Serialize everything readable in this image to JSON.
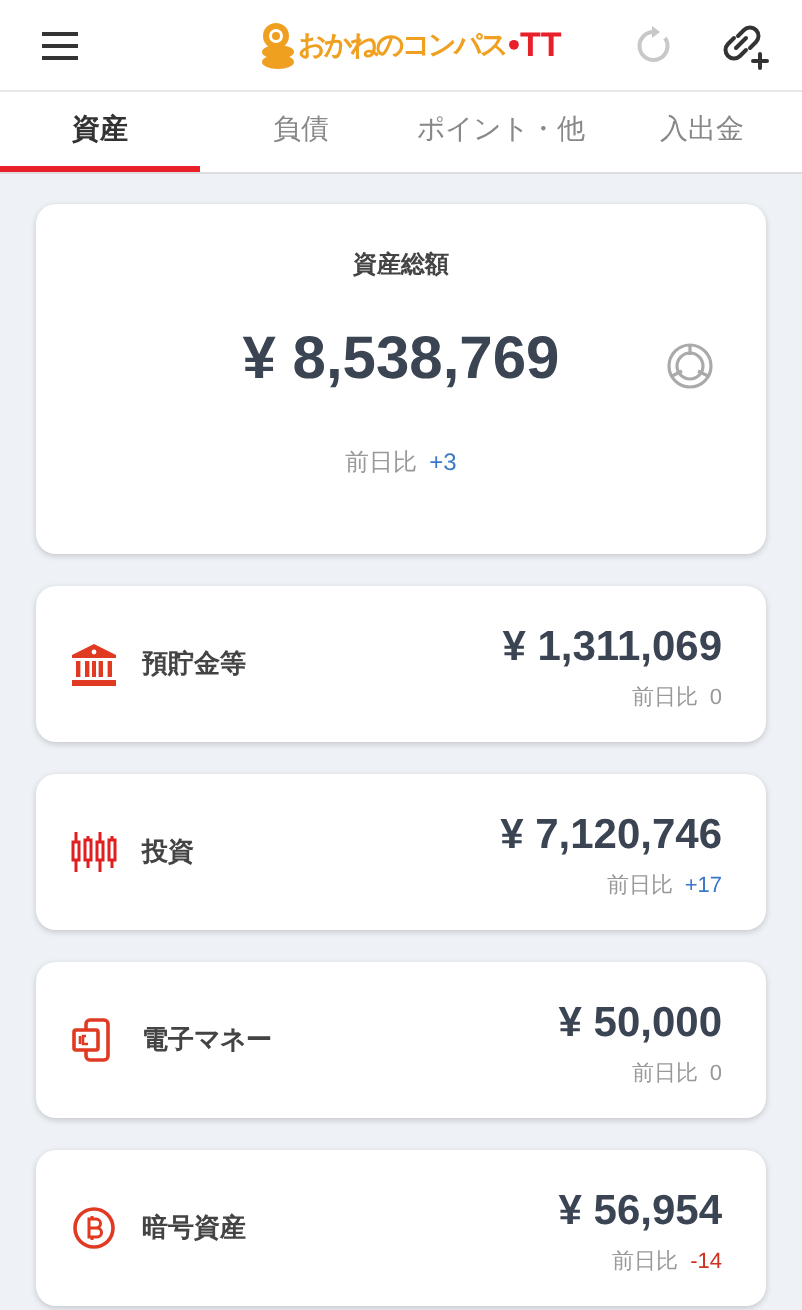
{
  "header": {
    "logo": {
      "name": "おかねのコンパス",
      "suffix": "•TT"
    }
  },
  "tabs": [
    {
      "label": "資産",
      "selected": true
    },
    {
      "label": "負債",
      "selected": false
    },
    {
      "label": "ポイント・他",
      "selected": false
    },
    {
      "label": "入出金",
      "selected": false
    }
  ],
  "summary": {
    "title": "資産総額",
    "amount": "¥ 8,538,769",
    "delta_label": "前日比",
    "delta": "+3",
    "color": "#3a78c8"
  },
  "categories": [
    {
      "kind": "bank",
      "name": "預貯金等",
      "amount": "¥ 1,311,069",
      "delta_label": "前日比",
      "delta": "0",
      "color": "#999999"
    },
    {
      "kind": "investment",
      "name": "投資",
      "amount": "¥ 7,120,746",
      "delta_label": "前日比",
      "delta": "+17",
      "color": "#3a78c8"
    },
    {
      "kind": "emoney",
      "name": "電子マネー",
      "amount": "¥ 50,000",
      "delta_label": "前日比",
      "delta": "0",
      "color": "#999999"
    },
    {
      "kind": "crypto",
      "name": "暗号資産",
      "amount": "¥ 56,954",
      "delta_label": "前日比",
      "delta": "-14",
      "color": "#d03020"
    }
  ]
}
